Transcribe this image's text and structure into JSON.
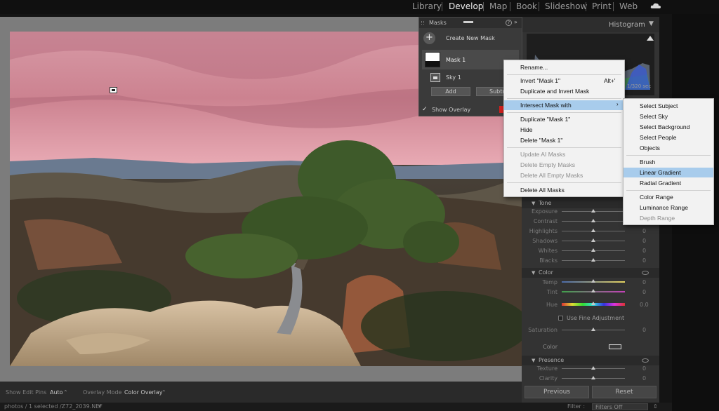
{
  "modules": [
    "Library",
    "Develop",
    "Map",
    "Book",
    "Slideshow",
    "Print",
    "Web"
  ],
  "active_module": "Develop",
  "histogram": {
    "title": "Histogram",
    "shutter": "1/320 sec"
  },
  "masks_panel": {
    "title": "Masks",
    "help_icon": "?",
    "collapse_icon": "»",
    "create_label": "Create New Mask",
    "mask_name": "Mask 1",
    "component_name": "Sky 1",
    "add_label": "Add",
    "subtract_label": "Subtract",
    "show_overlay_label": "Show Overlay",
    "overlay_checked": true,
    "overlay_color": "#d0201e"
  },
  "context_menu": [
    {
      "label": "Rename...",
      "shortcut": "",
      "disabled": false,
      "highlighted": false,
      "submenu": false
    },
    {
      "label": "Invert \"Mask 1\"",
      "shortcut": "Alt+'",
      "disabled": false,
      "highlighted": false,
      "submenu": false
    },
    {
      "label": "Duplicate and Invert Mask",
      "shortcut": "",
      "disabled": false,
      "highlighted": false,
      "submenu": false
    },
    {
      "label": "Intersect Mask with",
      "shortcut": "",
      "disabled": false,
      "highlighted": true,
      "submenu": true
    },
    {
      "label": "Duplicate \"Mask 1\"",
      "shortcut": "",
      "disabled": false,
      "highlighted": false,
      "submenu": false
    },
    {
      "label": "Hide",
      "shortcut": "",
      "disabled": false,
      "highlighted": false,
      "submenu": false
    },
    {
      "label": "Delete \"Mask 1\"",
      "shortcut": "",
      "disabled": false,
      "highlighted": false,
      "submenu": false
    },
    {
      "label": "Update AI Masks",
      "shortcut": "",
      "disabled": true,
      "highlighted": false,
      "submenu": false
    },
    {
      "label": "Delete Empty Masks",
      "shortcut": "",
      "disabled": true,
      "highlighted": false,
      "submenu": false
    },
    {
      "label": "Delete All Empty Masks",
      "shortcut": "",
      "disabled": true,
      "highlighted": false,
      "submenu": false
    },
    {
      "label": "Delete All Masks",
      "shortcut": "",
      "disabled": false,
      "highlighted": false,
      "submenu": false
    }
  ],
  "submenu": [
    {
      "label": "Select Subject",
      "disabled": false,
      "highlighted": false
    },
    {
      "label": "Select Sky",
      "disabled": false,
      "highlighted": false
    },
    {
      "label": "Select Background",
      "disabled": false,
      "highlighted": false
    },
    {
      "label": "Select People",
      "disabled": false,
      "highlighted": false
    },
    {
      "label": "Objects",
      "disabled": false,
      "highlighted": false
    },
    {
      "label": "Brush",
      "disabled": false,
      "highlighted": false
    },
    {
      "label": "Linear Gradient",
      "disabled": false,
      "highlighted": true
    },
    {
      "label": "Radial Gradient",
      "disabled": false,
      "highlighted": false
    },
    {
      "label": "Color Range",
      "disabled": false,
      "highlighted": false
    },
    {
      "label": "Luminance Range",
      "disabled": false,
      "highlighted": false
    },
    {
      "label": "Depth Range",
      "disabled": true,
      "highlighted": false
    }
  ],
  "tone": {
    "title": "Tone",
    "sliders": [
      {
        "label": "Exposure",
        "value": "0"
      },
      {
        "label": "Contrast",
        "value": "0"
      },
      {
        "label": "Highlights",
        "value": "0"
      },
      {
        "label": "Shadows",
        "value": "0"
      },
      {
        "label": "Whites",
        "value": "0"
      },
      {
        "label": "Blacks",
        "value": "0"
      }
    ]
  },
  "color_section": {
    "title": "Color",
    "temp_label": "Temp",
    "temp_value": "0",
    "tint_label": "Tint",
    "tint_value": "0",
    "hue_label": "Hue",
    "hue_value": "0.0",
    "fine_label": "Use Fine Adjustment",
    "saturation_label": "Saturation",
    "saturation_value": "0",
    "color_label": "Color"
  },
  "presence": {
    "title": "Presence",
    "texture_label": "Texture",
    "texture_value": "0",
    "clarity_label": "Clarity",
    "clarity_value": "0"
  },
  "buttons": {
    "previous": "Previous",
    "reset": "Reset"
  },
  "toolbar": {
    "edit_pins_label": "Show Edit Pins",
    "edit_pins_value": "Auto",
    "overlay_mode_label": "Overlay Mode",
    "overlay_mode_value": "Color Overlay"
  },
  "status_bar": {
    "path": "photos / 1 selected /Z72_2039.NEF",
    "filter_label": "Filter :",
    "filter_value": "Filters Off"
  }
}
